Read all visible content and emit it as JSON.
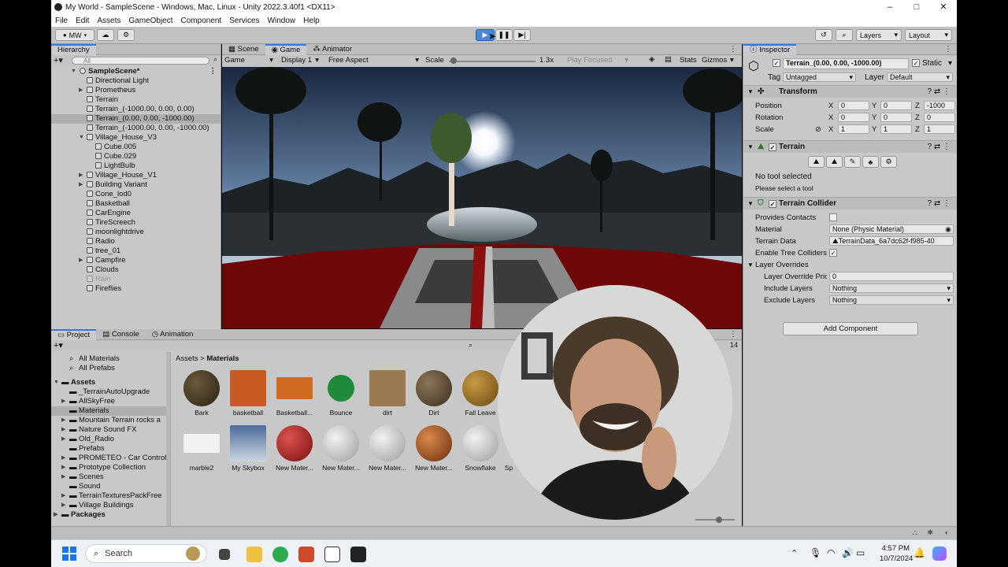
{
  "window": {
    "title": "My World - SampleScene - Windows, Mac, Linux - Unity 2022.3.40f1 <DX11>"
  },
  "menu": [
    "File",
    "Edit",
    "Assets",
    "GameObject",
    "Component",
    "Services",
    "Window",
    "Help"
  ],
  "toolbar": {
    "account": "MW",
    "layers": "Layers",
    "layout": "Layout"
  },
  "hierarchy": {
    "tab": "Hierarchy",
    "search_placeholder": "All",
    "scene": "SampleScene*",
    "items": [
      {
        "label": "Directional Light"
      },
      {
        "label": "Prometheus"
      },
      {
        "label": "Terrain"
      },
      {
        "label": "Terrain_(-1000.00, 0.00, 0.00)"
      },
      {
        "label": "Terrain_(0.00, 0.00, -1000.00)"
      },
      {
        "label": "Terrain_(-1000.00, 0.00, -1000.00)"
      },
      {
        "label": "Village_House_V3"
      },
      {
        "label": "Cube.005"
      },
      {
        "label": "Cube.029"
      },
      {
        "label": "LightBulb"
      },
      {
        "label": "Village_House_V1"
      },
      {
        "label": "Building Variant"
      },
      {
        "label": "Cone_lod0"
      },
      {
        "label": "Basketball"
      },
      {
        "label": "CarEngine"
      },
      {
        "label": "TireScreech"
      },
      {
        "label": "moonlightdrive"
      },
      {
        "label": "Radio"
      },
      {
        "label": "tree_01"
      },
      {
        "label": "Campfire"
      },
      {
        "label": "Clouds"
      },
      {
        "label": "Rain"
      },
      {
        "label": "Fireflies"
      }
    ]
  },
  "center_tabs": [
    "Scene",
    "Game",
    "Animator"
  ],
  "game_bar": {
    "mode": "Game",
    "display": "Display 1",
    "aspect": "Free Aspect",
    "scale_label": "Scale",
    "scale_value": "1.3x",
    "scale_level": 0.05,
    "play_focused": "Play Focused",
    "stats": "Stats",
    "gizmos": "Gizmos"
  },
  "bottom_tabs": [
    "Project",
    "Console",
    "Animation"
  ],
  "project": {
    "count": "14",
    "favorites": [
      "All Materials",
      "All Prefabs"
    ],
    "root": "Assets",
    "folders": [
      "_TerrainAutoUpgrade",
      "AllSkyFree",
      "Materials",
      "Mountain Terrain rocks a",
      "Nature Sound FX",
      "Old_Radio",
      "Prefabs",
      "PROMETEO - Car Control",
      "Prototype Collection",
      "Scenes",
      "Sound",
      "TerrainTexturesPackFree",
      "Village Buildings"
    ],
    "packages": "Packages",
    "breadcrumb": [
      "Assets",
      "Materials"
    ],
    "assets_row1": [
      "Bark",
      "basketball",
      "Basketball...",
      "Bounce",
      "dirt",
      "Dirt",
      "Fall Leave"
    ],
    "assets_row2": [
      "marble2",
      "My Skybox",
      "New Mater...",
      "New Mater...",
      "New Mater...",
      "New Mater...",
      "Snowflake",
      "Sp"
    ]
  },
  "inspector": {
    "tab": "Inspector",
    "object_name": "Terrain_(0.00, 0.00, -1000.00)",
    "static": "Static",
    "tag_label": "Tag",
    "tag": "Untagged",
    "layer_label": "Layer",
    "layer": "Default",
    "transform": {
      "title": "Transform",
      "position_label": "Position",
      "rotation_label": "Rotation",
      "scale_label": "Scale",
      "axis": [
        "X",
        "Y",
        "Z"
      ],
      "position": [
        "0",
        "0",
        "-1000"
      ],
      "rotation": [
        "0",
        "0",
        "0"
      ],
      "scale": [
        "1",
        "1",
        "1"
      ]
    },
    "terrain": {
      "title": "Terrain",
      "no_tool": "No tool selected",
      "please": "Please select a tool"
    },
    "collider": {
      "title": "Terrain Collider",
      "provides_contacts": "Provides Contacts",
      "material_label": "Material",
      "material": "None (Physic Material)",
      "terrain_data_label": "Terrain Data",
      "terrain_data": "TerrainData_6a7dc62f-f985-40",
      "enable_tree": "Enable Tree Colliders",
      "layer_overrides": "Layer Overrides",
      "override_priority_label": "Layer Override Pric",
      "override_priority": "0",
      "include_label": "Include Layers",
      "include": "Nothing",
      "exclude_label": "Exclude Layers",
      "exclude": "Nothing"
    },
    "add_component": "Add Component"
  },
  "taskbar": {
    "search": "Search",
    "time": "4:57 PM",
    "date": "10/7/2024"
  },
  "colors": {
    "accent": "#3a79d8",
    "panel": "#c8c8c8",
    "car_red": "#8b0f0f"
  }
}
